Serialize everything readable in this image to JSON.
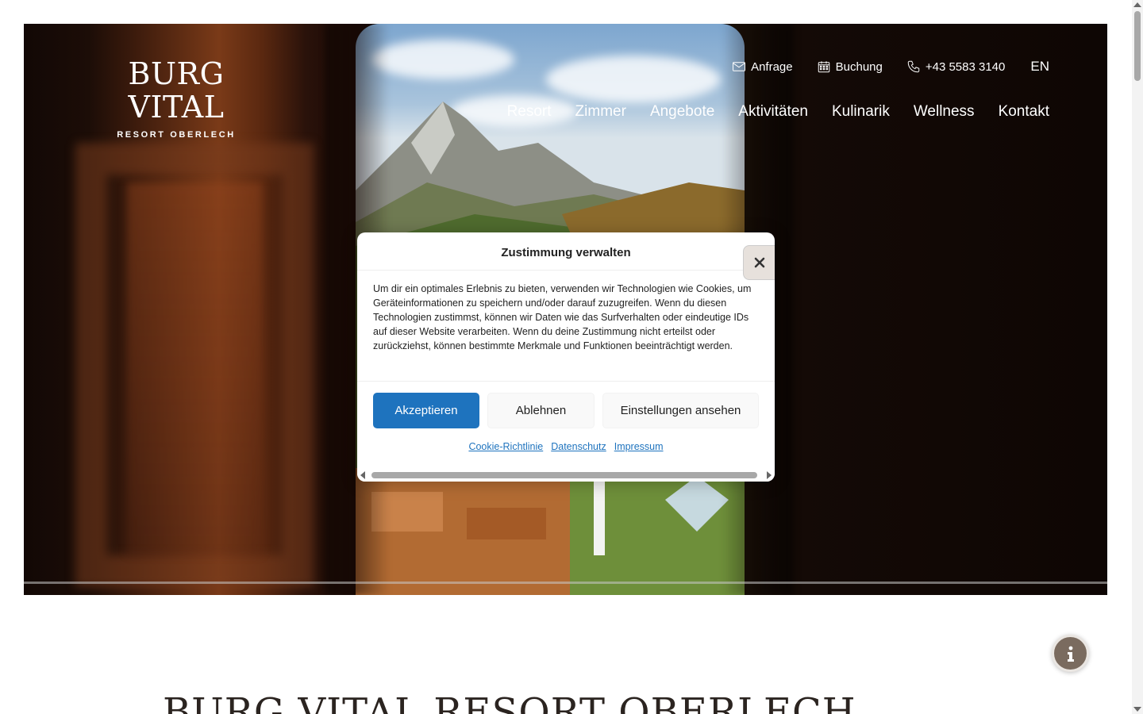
{
  "logo": {
    "main": "BURG VITAL",
    "sub": "RESORT OBERLECH"
  },
  "top_links": {
    "inquiry": {
      "label": "Anfrage",
      "icon": "envelope-icon"
    },
    "booking": {
      "label": "Buchung",
      "icon": "calendar-icon"
    },
    "phone": {
      "label": "+43 5583 3140",
      "icon": "phone-icon"
    },
    "language": "EN"
  },
  "nav": {
    "items": [
      {
        "label": "Resort"
      },
      {
        "label": "Zimmer"
      },
      {
        "label": "Angebote"
      },
      {
        "label": "Aktivitäten"
      },
      {
        "label": "Kulinarik"
      },
      {
        "label": "Wellness"
      },
      {
        "label": "Kontakt"
      }
    ]
  },
  "consent": {
    "title": "Zustimmung verwalten",
    "close_icon": "close-icon",
    "body": "Um dir ein optimales Erlebnis zu bieten, verwenden wir Technologien wie Cookies, um Geräteinformationen zu speichern und/oder darauf zuzugreifen. Wenn du diesen Technologien zustimmst, können wir Daten wie das Surfverhalten oder eindeutige IDs auf dieser Website verarbeiten. Wenn du deine Zustimmung nicht erteilst oder zurückziehst, können bestimmte Merkmale und Funktionen beeinträchtigt werden.",
    "accept_label": "Akzeptieren",
    "deny_label": "Ablehnen",
    "settings_label": "Einstellungen ansehen",
    "links": {
      "cookie_policy": "Cookie-Richtlinie",
      "privacy": "Datenschutz",
      "imprint": "Impressum"
    }
  },
  "info_button": {
    "icon": "info-icon"
  },
  "page_heading": "BURG VITAL RESORT OBERLECH",
  "colors": {
    "accent_blue": "#1e73be",
    "info_brown": "#7a6b5f",
    "heading": "#2b2420"
  }
}
